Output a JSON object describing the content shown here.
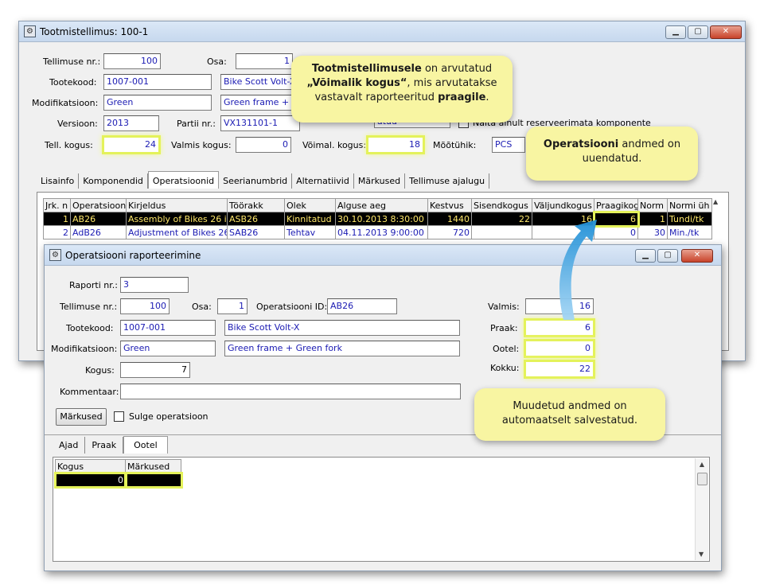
{
  "main_window": {
    "title": "Tootmistellimus: 100-1",
    "labels": {
      "order_no": "Tellimuse nr.:",
      "part": "Osa:",
      "product_code": "Tootekood:",
      "modification": "Modifikatsioon:",
      "version": "Versioon:",
      "batch_no": "Partii nr.:",
      "order_qty": "Tell. kogus:",
      "ready_qty": "Valmis kogus:",
      "possible_qty": "Võimal. kogus:",
      "unit": "Mõõtühik:",
      "show_unreserved": "Näita ainult reserveerimata komponente"
    },
    "values": {
      "order_no": "100",
      "part": "1",
      "product_code": "1007-001",
      "product_name": "Bike Scott Volt-X",
      "modification": "Green",
      "modification_desc": "Green frame + G",
      "version": "2013",
      "batch_no": "VX131101-1",
      "status": "atud",
      "order_qty": "24",
      "ready_qty": "0",
      "possible_qty": "18",
      "unit": "PCS"
    },
    "tabs": [
      "Lisainfo",
      "Komponendid",
      "Operatsioonid",
      "Seerianumbrid",
      "Alternatiivid",
      "Märkused",
      "Tellimuse ajalugu"
    ],
    "grid_headers": [
      "Jrk. n",
      "Operatsiooni",
      "Kirjeldus",
      "Töörakk",
      "Olek",
      "Alguse aeg",
      "Kestvus",
      "Sisendkogus",
      "Väljundkogus",
      "Praagikog",
      "Norm",
      "Normi üh"
    ],
    "grid_rows": [
      [
        "1",
        "AB26",
        "Assembly of Bikes 26 in",
        "ASB26",
        "Kinnitatud",
        "30.10.2013 8:30:00",
        "1440",
        "22",
        "16",
        "6",
        "1",
        "Tundi/tk"
      ],
      [
        "2",
        "AdB26",
        "Adjustment of Bikes 26",
        "SAB26",
        "Tehtav",
        "04.11.2013 9:00:00",
        "720",
        "",
        "",
        "0",
        "30",
        "Min./tk"
      ]
    ]
  },
  "report_window": {
    "title": "Operatsiooni raporteerimine",
    "labels": {
      "report_no": "Raporti nr.:",
      "order_no": "Tellimuse nr.:",
      "part": "Osa:",
      "operation_id": "Operatsiooni ID:",
      "product_code": "Tootekood:",
      "modification": "Modifikatsioon:",
      "qty": "Kogus:",
      "comment": "Kommentaar:",
      "ready": "Valmis:",
      "scrap": "Praak:",
      "waiting": "Ootel:",
      "total": "Kokku:"
    },
    "values": {
      "report_no": "3",
      "order_no": "100",
      "part": "1",
      "operation_id": "AB26",
      "product_code": "1007-001",
      "product_name": "Bike Scott Volt-X",
      "modification": "Green",
      "modification_desc": "Green frame + Green fork",
      "qty": "7",
      "comment": "",
      "ready": "16",
      "scrap": "6",
      "waiting": "0",
      "total": "22"
    },
    "notes_button": "Märkused",
    "close_operation": "Sulge operatsioon",
    "tabs": [
      "Ajad",
      "Praak",
      "Ootel"
    ],
    "grid_headers": [
      "Kogus",
      "Märkused"
    ],
    "grid_rows": [
      [
        "0",
        ""
      ]
    ]
  },
  "callouts": {
    "c1": [
      "Tootmistellimusele",
      " on arvutatud ",
      "„Võimalik kogus“",
      ", mis arvutatakse vastavalt raporteeritud ",
      "praagile",
      "."
    ],
    "c2": [
      "Operatsiooni",
      " andmed on uuendatud."
    ],
    "c3": "Muudetud andmed on automaatselt salvestatud."
  },
  "colors": {
    "highlight": "#e4f25a",
    "callout_bg": "#f8f5a2",
    "arrow": "#2e9ad8",
    "value_text": "#1b1bb3"
  }
}
